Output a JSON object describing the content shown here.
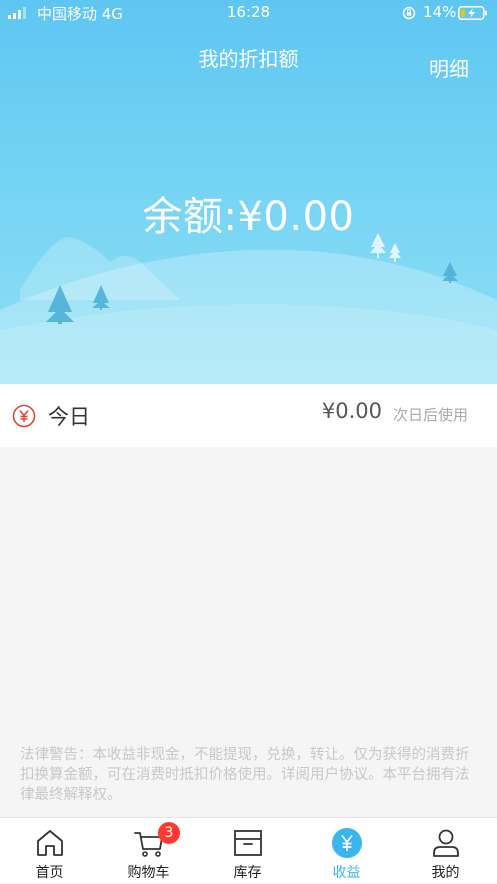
{
  "status_bar": {
    "carrier": "中国移动  4G",
    "time": "16:28",
    "battery": "14%"
  },
  "header": {
    "title": "我的折扣额",
    "detail_label": "明细"
  },
  "balance": {
    "text": "余额:¥0.00"
  },
  "today": {
    "icon": "yen-circle-icon",
    "label": "今日",
    "amount": "¥0.00",
    "note": "次日后使用"
  },
  "legal": {
    "text": "法律警告：本收益非现金，不能提现，兑换，转让。仅为获得的消费折扣换算金额，可在消费时抵扣价格使用。详阅用户协议。本平台拥有法律最终解释权。"
  },
  "tabbar": {
    "items": [
      {
        "label": "首页",
        "icon": "home-icon"
      },
      {
        "label": "购物车",
        "icon": "cart-icon",
        "badge": "3"
      },
      {
        "label": "库存",
        "icon": "inventory-box-icon"
      },
      {
        "label": "收益",
        "icon": "yen-circle-icon",
        "active": true
      },
      {
        "label": "我的",
        "icon": "user-icon"
      }
    ]
  },
  "colors": {
    "accent": "#39b7ec",
    "hero_top": "#5ec6f1",
    "hero_bottom": "#8fe0f5",
    "badge": "#ff3b30",
    "yen_icon": "#e0473a"
  }
}
